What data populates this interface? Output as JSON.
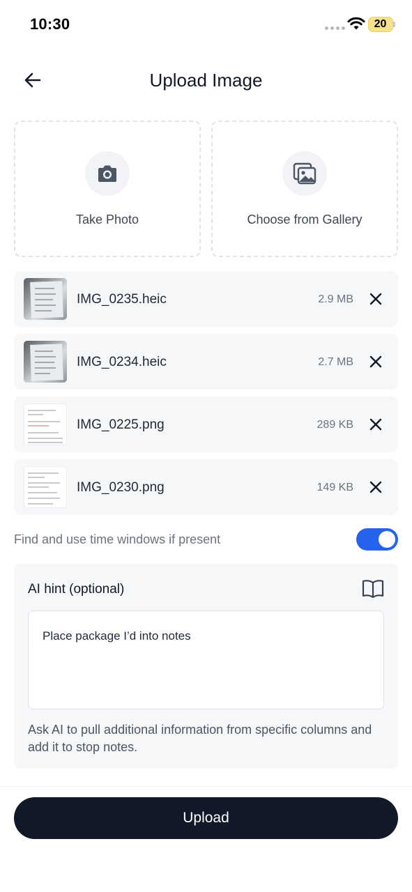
{
  "status_bar": {
    "time": "10:30",
    "battery": "20"
  },
  "header": {
    "title": "Upload Image"
  },
  "sources": {
    "camera_label": "Take Photo",
    "gallery_label": "Choose from Gallery"
  },
  "files": [
    {
      "name": "IMG_0235.heic",
      "size": "2.9 MB",
      "thumb": "photo"
    },
    {
      "name": "IMG_0234.heic",
      "size": "2.7 MB",
      "thumb": "photo"
    },
    {
      "name": "IMG_0225.png",
      "size": "289 KB",
      "thumb": "document"
    },
    {
      "name": "IMG_0230.png",
      "size": "149 KB",
      "thumb": "document"
    }
  ],
  "time_windows": {
    "label": "Find and use time windows if present",
    "enabled": true
  },
  "ai_hint": {
    "title": "AI hint (optional)",
    "value": "Place package I’d into notes",
    "help": "Ask AI to pull additional information from specific columns and add it to stop notes."
  },
  "actions": {
    "upload_label": "Upload"
  },
  "colors": {
    "accent": "#2563eb",
    "primary_button": "#111827"
  }
}
